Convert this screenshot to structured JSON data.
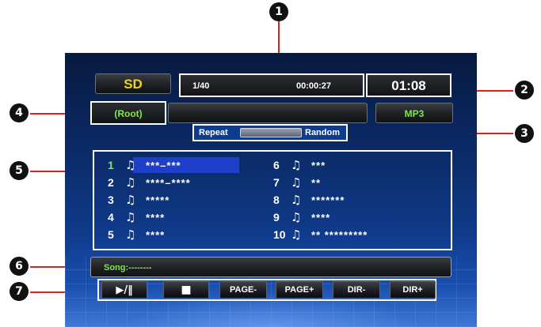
{
  "callouts": [
    "1",
    "2",
    "3",
    "4",
    "5",
    "6",
    "7"
  ],
  "header": {
    "source_label": "SD",
    "track_position": "1/40",
    "elapsed_time": "00:00:27",
    "clock": "01:08"
  },
  "folder": {
    "current": "(Root)",
    "format": "MP3"
  },
  "mode": {
    "left_label": "Repeat",
    "right_label": "Random"
  },
  "playlist": {
    "left": [
      {
        "num": "1",
        "name": "***–***",
        "selected": true
      },
      {
        "num": "2",
        "name": "****–****"
      },
      {
        "num": "3",
        "name": "*****"
      },
      {
        "num": "4",
        "name": "****"
      },
      {
        "num": "5",
        "name": "****"
      }
    ],
    "right": [
      {
        "num": "6",
        "name": "***"
      },
      {
        "num": "7",
        "name": "**"
      },
      {
        "num": "8",
        "name": "*******"
      },
      {
        "num": "9",
        "name": "****"
      },
      {
        "num": "10",
        "name": "**  *********"
      }
    ],
    "note_icon": "music-note-icon"
  },
  "song_bar": {
    "text": "Song:--------"
  },
  "controls": {
    "play_pause": "▶/‖",
    "stop": "■",
    "page_minus": "PAGE-",
    "page_plus": "PAGE+",
    "dir_minus": "DIR-",
    "dir_plus": "DIR+"
  },
  "colors": {
    "accent_yellow": "#f2d21a",
    "accent_green": "#7ee84a",
    "selection_blue": "#1f3ec9",
    "callout_red": "#e0201b"
  }
}
